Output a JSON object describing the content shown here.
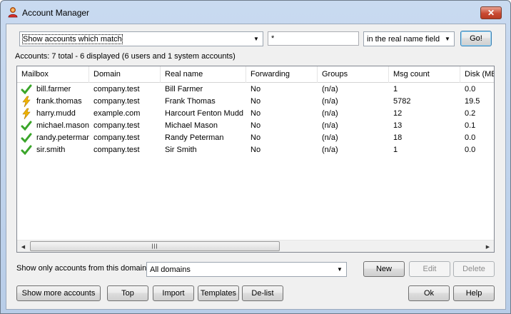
{
  "window": {
    "title": "Account Manager",
    "close_symbol": "✕"
  },
  "filter": {
    "match_mode": "Show accounts which match",
    "pattern": "*",
    "field": "in the real name field",
    "go_label": "Go!"
  },
  "summary": "Accounts:  7 total - 6 displayed (6 users and 1 system accounts)",
  "table": {
    "columns": [
      "Mailbox",
      "Domain",
      "Real name",
      "Forwarding",
      "Groups",
      "Msg count",
      "Disk (MB"
    ],
    "rows": [
      {
        "icon": "check-icon",
        "mailbox": "bill.farmer",
        "domain": "company.test",
        "real_name": "Bill Farmer",
        "forwarding": "No",
        "groups": "(n/a)",
        "msg_count": "1",
        "disk": "0.0"
      },
      {
        "icon": "lightning-icon",
        "mailbox": "frank.thomas",
        "domain": "company.test",
        "real_name": "Frank Thomas",
        "forwarding": "No",
        "groups": "(n/a)",
        "msg_count": "5782",
        "disk": "19.5"
      },
      {
        "icon": "lightning-icon",
        "mailbox": "harry.mudd",
        "domain": "example.com",
        "real_name": "Harcourt Fenton Mudd",
        "forwarding": "No",
        "groups": "(n/a)",
        "msg_count": "12",
        "disk": "0.2"
      },
      {
        "icon": "check-icon",
        "mailbox": "michael.mason",
        "domain": "company.test",
        "real_name": "Michael Mason",
        "forwarding": "No",
        "groups": "(n/a)",
        "msg_count": "13",
        "disk": "0.1"
      },
      {
        "icon": "check-icon",
        "mailbox": "randy.peterman",
        "domain": "company.test",
        "real_name": "Randy Peterman",
        "forwarding": "No",
        "groups": "(n/a)",
        "msg_count": "18",
        "disk": "0.0"
      },
      {
        "icon": "check-icon",
        "mailbox": "sir.smith",
        "domain": "company.test",
        "real_name": "Sir Smith",
        "forwarding": "No",
        "groups": "(n/a)",
        "msg_count": "1",
        "disk": "0.0"
      }
    ],
    "scrollbar": {
      "left": "◀",
      "right": "▶",
      "grip": "|||"
    }
  },
  "domain_filter": {
    "label": "Show only accounts from this domain",
    "value": "All domains"
  },
  "buttons": {
    "new": "New",
    "edit": "Edit",
    "delete": "Delete",
    "show_more": "Show more accounts",
    "top": "Top",
    "import": "Import",
    "templates": "Templates",
    "delist": "De-list",
    "ok": "Ok",
    "help": "Help"
  },
  "colors": {
    "check": "#3aa52a",
    "lightning": "#f0b400"
  }
}
